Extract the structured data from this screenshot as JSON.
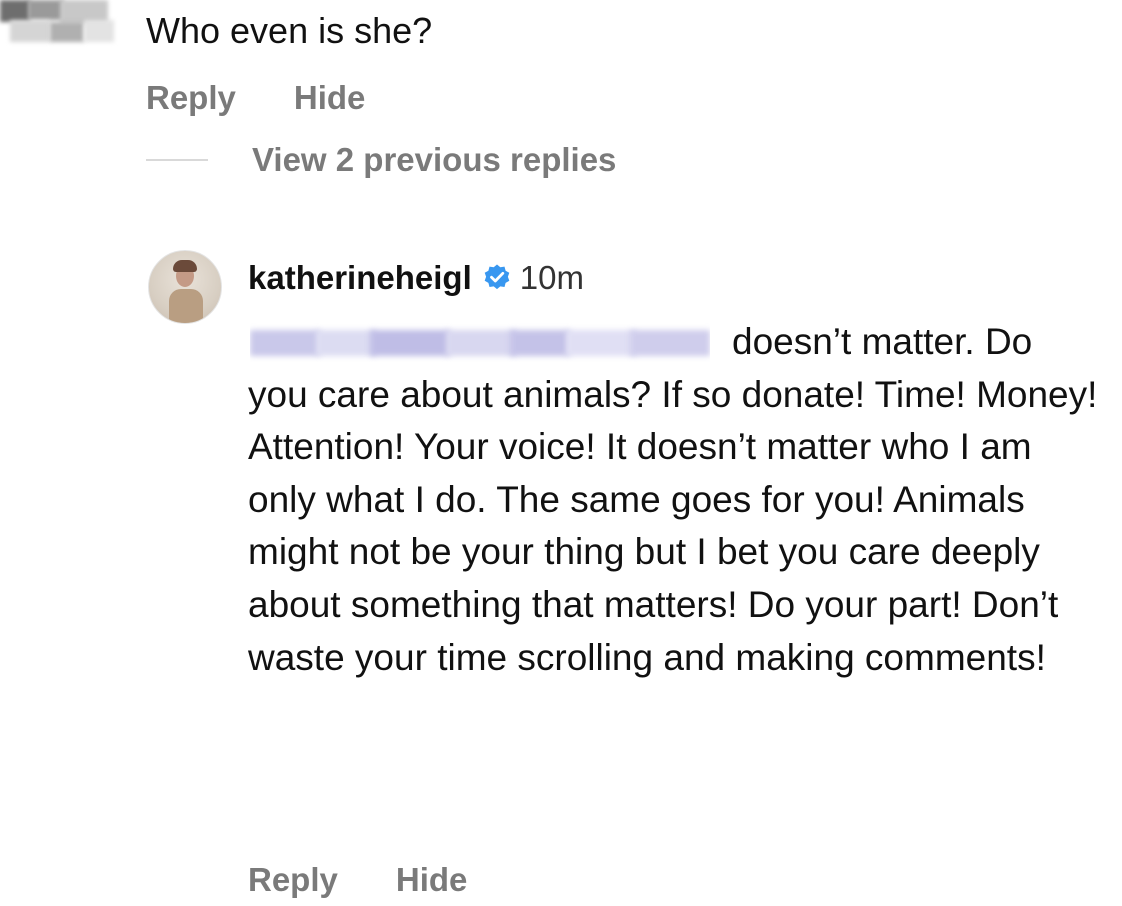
{
  "top_comment": {
    "text": "Who even is she?",
    "actions": {
      "reply": "Reply",
      "hide": "Hide"
    }
  },
  "view_replies": {
    "label": "View 2 previous replies"
  },
  "reply": {
    "username": "katherineheigl",
    "verified": true,
    "timestamp": "10m",
    "text": "doesn’t matter. Do you care about animals? If so donate! Time! Money! Attention! Your voice! It doesn’t matter who I am only what I do. The same goes for you! Animals might not be your thing but I bet you care deeply about something that matters! Do your part! Don’t waste your time scrolling and making comments!",
    "actions": {
      "reply": "Reply",
      "hide": "Hide"
    }
  },
  "colors": {
    "verified_badge": "#3897f0",
    "secondary_text": "#7a7a7a",
    "redaction": "#c9c8ea"
  },
  "icons": {
    "verified": "verified-badge-icon"
  }
}
